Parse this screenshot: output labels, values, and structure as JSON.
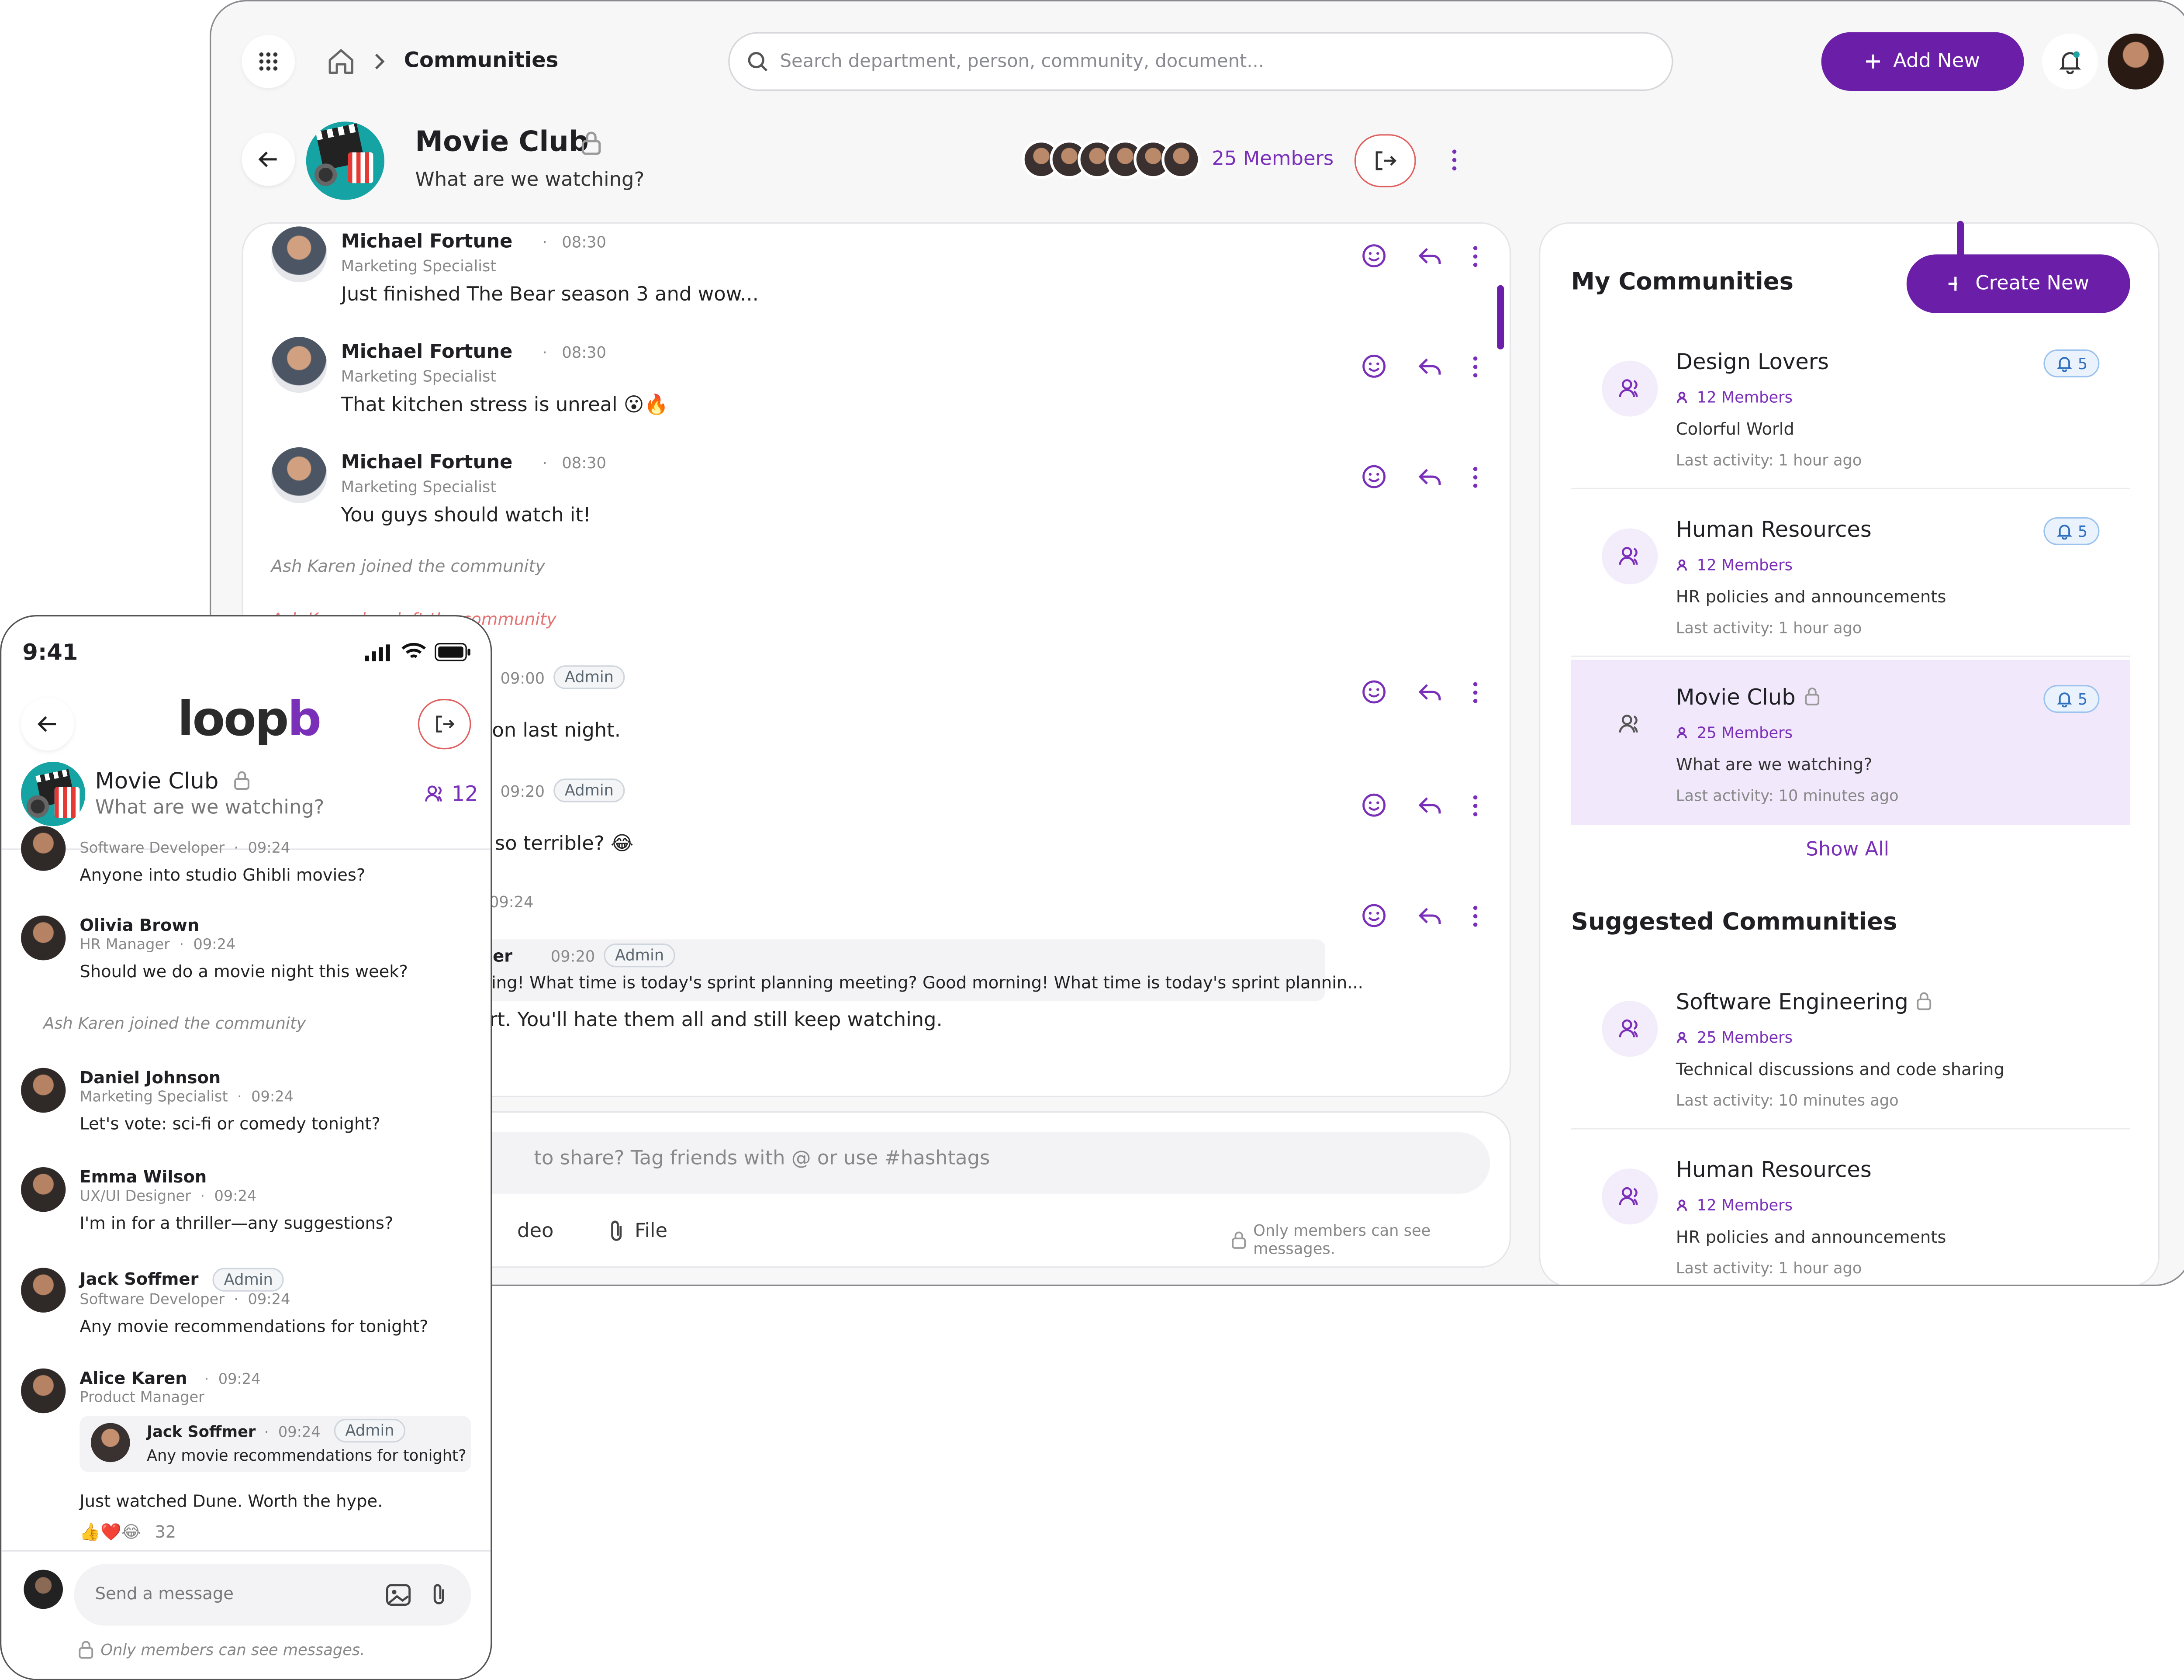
{
  "desktop": {
    "breadcrumb": {
      "current": "Communities"
    },
    "search": {
      "placeholder": "Search department, person, community, document..."
    },
    "add_new_label": "Add New",
    "community": {
      "name": "Movie Club",
      "description": "What are we watching?",
      "members_label": "25 Members"
    },
    "messages": [
      {
        "author": "Michael Fortune",
        "time": "08:30",
        "role": "Marketing Specialist",
        "text": "Just finished The Bear season 3 and wow..."
      },
      {
        "author": "Michael Fortune",
        "time": "08:30",
        "role": "Marketing Specialist",
        "text": "That kitchen stress is unreal 😮🔥"
      },
      {
        "author": "Michael Fortune",
        "time": "08:30",
        "role": "Marketing Specialist",
        "text": "You guys should watch it!"
      }
    ],
    "system_events": [
      "Ash Karen joined the community",
      "Ash Karen has left the community"
    ],
    "partial_messages": [
      {
        "time": "09:00",
        "badge": "Admin",
        "text": "on last night."
      },
      {
        "time": "09:20",
        "badge": "Admin",
        "text": "so terrible? 😂"
      },
      {
        "time": "09:24",
        "text": "rt. You'll hate them all and still keep watching."
      }
    ],
    "quoted": {
      "author_fragment": "her",
      "time": "09:20",
      "badge": "Admin",
      "text": "ning! What time is today's sprint planning meeting? Good morning! What time is today's sprint plannin..."
    },
    "composer": {
      "placeholder": "to share? Tag friends with @ or use #hashtags",
      "video_label": "deo",
      "file_label": "File",
      "privacy_note": "Only members can see messages."
    },
    "my_communities": {
      "title": "My Communities",
      "create_label": "Create New",
      "items": [
        {
          "name": "Design Lovers",
          "members": "12 Members",
          "description": "Colorful World",
          "activity": "Last activity: 1 hour ago",
          "notifications": "5",
          "locked": false
        },
        {
          "name": "Human Resources",
          "members": "12 Members",
          "description": "HR policies and announcements",
          "activity": "Last activity: 1 hour ago",
          "notifications": "5",
          "locked": false
        },
        {
          "name": "Movie Club",
          "members": "25 Members",
          "description": "What are we watching?",
          "activity": "Last activity: 10 minutes ago",
          "notifications": "5",
          "locked": true
        }
      ],
      "show_all_label": "Show All"
    },
    "suggested": {
      "title": "Suggested Communities",
      "items": [
        {
          "name": "Software Engineering",
          "members": "25 Members",
          "description": "Technical discussions and code sharing",
          "activity": "Last activity: 10 minutes ago",
          "locked": true
        },
        {
          "name": "Human Resources",
          "members": "12 Members",
          "description": "HR policies and announcements",
          "activity": "Last activity: 1 hour ago",
          "locked": false
        }
      ]
    }
  },
  "phone": {
    "time": "9:41",
    "logo": {
      "left": "lo",
      "mid": "o",
      "right": "p",
      "end": "b"
    },
    "community": {
      "name": "Movie Club",
      "description": "What are we watching?",
      "member_count": "12"
    },
    "messages": [
      {
        "author": "",
        "role": "Software Developer",
        "time": "09:24",
        "text": "Anyone into studio Ghibli movies?"
      },
      {
        "author": "Olivia Brown",
        "role": "HR Manager",
        "time": "09:24",
        "text": "Should we do a movie night this week?"
      },
      {
        "author": "Daniel Johnson",
        "role": "Marketing Specialist",
        "time": "09:24",
        "text": "Let's vote: sci-fi or comedy tonight?"
      },
      {
        "author": "Emma Wilson",
        "role": "UX/UI Designer",
        "time": "09:24",
        "text": "I'm in for a thriller—any suggestions?"
      },
      {
        "author": "Jack Soffmer",
        "role": "Software Developer",
        "time": "09:24",
        "badge": "Admin",
        "text": "Any movie recommendations for tonight?"
      },
      {
        "author": "Alice Karen",
        "role": "Product Manager",
        "time": "09:24",
        "text": "Just watched Dune. Worth the hype."
      }
    ],
    "system_event": "Ash Karen joined the community",
    "quoted": {
      "author": "Jack Soffmer",
      "time": "09:24",
      "badge": "Admin",
      "text": "Any movie recommendations for tonight?"
    },
    "reactions": {
      "emojis": "👍❤️😂",
      "count": "32"
    },
    "composer": {
      "placeholder": "Send a message",
      "privacy_note": "Only members can see messages."
    }
  },
  "colors": {
    "accent": "#6b1fa8",
    "leave": "#e06060",
    "bell_badge": "#2e6fbf"
  },
  "icons": [
    "apps-grid-icon",
    "home-icon",
    "chevron-right-icon",
    "search-icon",
    "plus-icon",
    "bell-icon",
    "back-arrow-icon",
    "lock-icon",
    "leave-icon",
    "more-vertical-icon",
    "emoji-icon",
    "reply-icon",
    "attach-icon",
    "users-icon",
    "image-icon"
  ]
}
